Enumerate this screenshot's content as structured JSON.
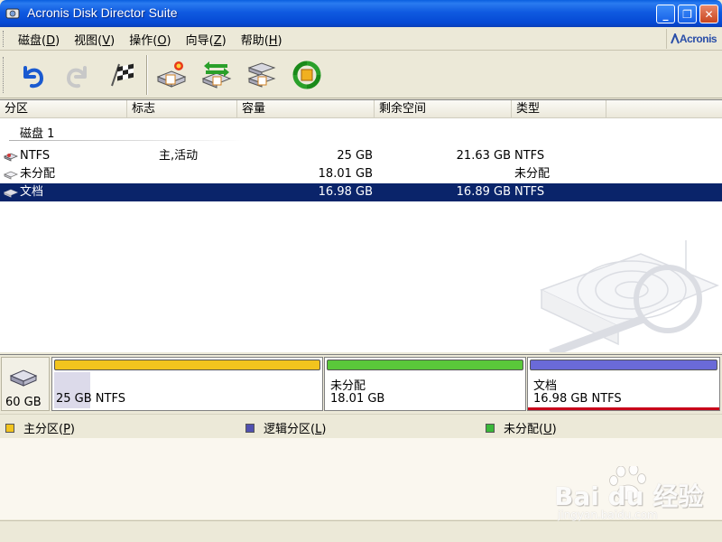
{
  "window": {
    "title": "Acronis Disk Director Suite",
    "minimize_glyph": "_",
    "maximize_glyph": "❐",
    "close_glyph": "✕"
  },
  "menu": [
    {
      "label": "磁盘(",
      "accel": "D",
      "suffix": ")"
    },
    {
      "label": "视图(",
      "accel": "V",
      "suffix": ")"
    },
    {
      "label": "操作(",
      "accel": "O",
      "suffix": ")"
    },
    {
      "label": "向导(",
      "accel": "Z",
      "suffix": ")"
    },
    {
      "label": "帮助(",
      "accel": "H",
      "suffix": ")"
    }
  ],
  "brand": "Acronis",
  "toolbar": {
    "icons": [
      "undo-icon",
      "redo-icon",
      "commit-flag-icon",
      "create-partition-icon",
      "copy-partition-icon",
      "recover-partition-icon",
      "recycle-icon"
    ]
  },
  "columns": [
    "分区",
    "标志",
    "容量",
    "剩余空间",
    "类型"
  ],
  "disk_label": "磁盘 1",
  "rows": [
    {
      "name": "NTFS",
      "flags": "主,活动",
      "capacity": "25 GB",
      "free": "21.63 GB",
      "type": "NTFS",
      "selected": false
    },
    {
      "name": "未分配",
      "flags": "",
      "capacity": "18.01 GB",
      "free": "",
      "type": "未分配",
      "selected": false
    },
    {
      "name": "文档",
      "flags": "",
      "capacity": "16.98 GB",
      "free": "16.89 GB",
      "type": "NTFS",
      "selected": true
    }
  ],
  "diskmap": {
    "disk_size": "60 GB",
    "partitions": [
      {
        "line1": "",
        "line2": "25 GB  NTFS",
        "bar_color": "#f2c41e"
      },
      {
        "line1": "未分配",
        "line2": "18.01 GB",
        "bar_color": "#5ac83a"
      },
      {
        "line1": "文档",
        "line2": "16.98 GB  NTFS",
        "bar_color": "#6a6ad8"
      }
    ]
  },
  "legend": [
    {
      "label": "主分区(",
      "accel": "P",
      "suffix": ")",
      "color": "#f2c41e"
    },
    {
      "label": "逻辑分区(",
      "accel": "L",
      "suffix": ")",
      "color": "#5050b0"
    },
    {
      "label": "未分配(",
      "accel": "U",
      "suffix": ")",
      "color": "#3ab83a"
    }
  ],
  "watermark": {
    "text": "Bai du 经验",
    "url": "jingyan.baidu.com"
  }
}
